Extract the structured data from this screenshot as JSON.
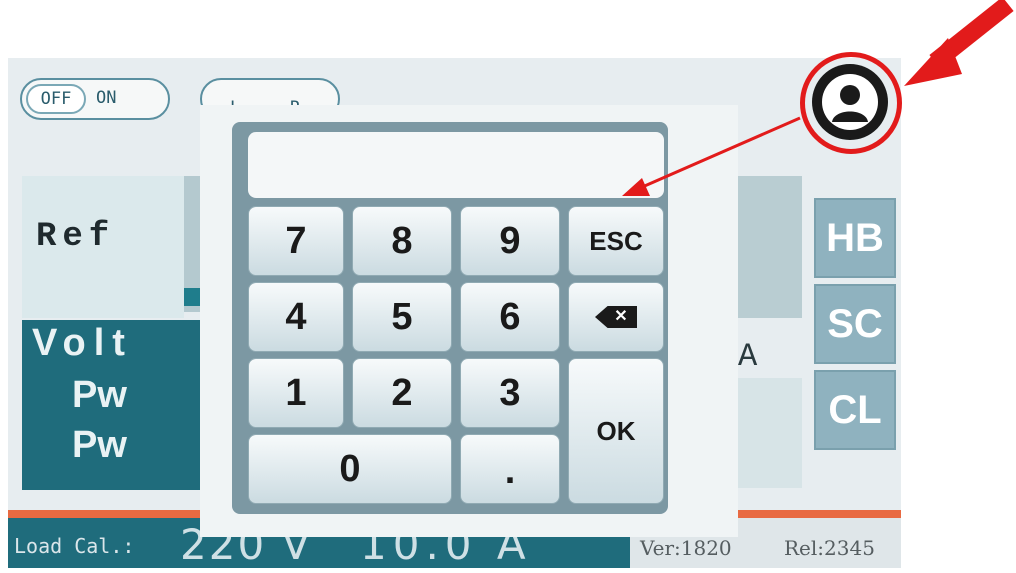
{
  "power_toggle": {
    "off_label": "OFF",
    "on_label": "ON"
  },
  "mode_toggle": {
    "left_label": "L",
    "right_label": "R"
  },
  "left_panel": {
    "ref_label": "Ref",
    "volt_label": "Volt",
    "pw1_label": "Pw",
    "pw2_label": "Pw"
  },
  "right_panel": {
    "amp_fragment": "A",
    "hb_label": "HB",
    "sc_label": "SC",
    "cl_label": "CL"
  },
  "status_bar": {
    "load_label": "Load Cal.:",
    "voltage": "220 V",
    "current": "10.0 A",
    "version": "Ver:1820",
    "release": "Rel:2345"
  },
  "keypad": {
    "display_value": "",
    "keys": {
      "k7": "7",
      "k8": "8",
      "k9": "9",
      "esc": "ESC",
      "k4": "4",
      "k5": "5",
      "k6": "6",
      "k1": "1",
      "k2": "2",
      "k3": "3",
      "ok": "OK",
      "k0": "0",
      "dot": "."
    }
  },
  "icons": {
    "user": "user-icon",
    "backspace": "backspace-icon"
  },
  "colors": {
    "accent_teal": "#1f6c7c",
    "annotation_red": "#e21b1b",
    "orange_stripe": "#e86a42"
  }
}
